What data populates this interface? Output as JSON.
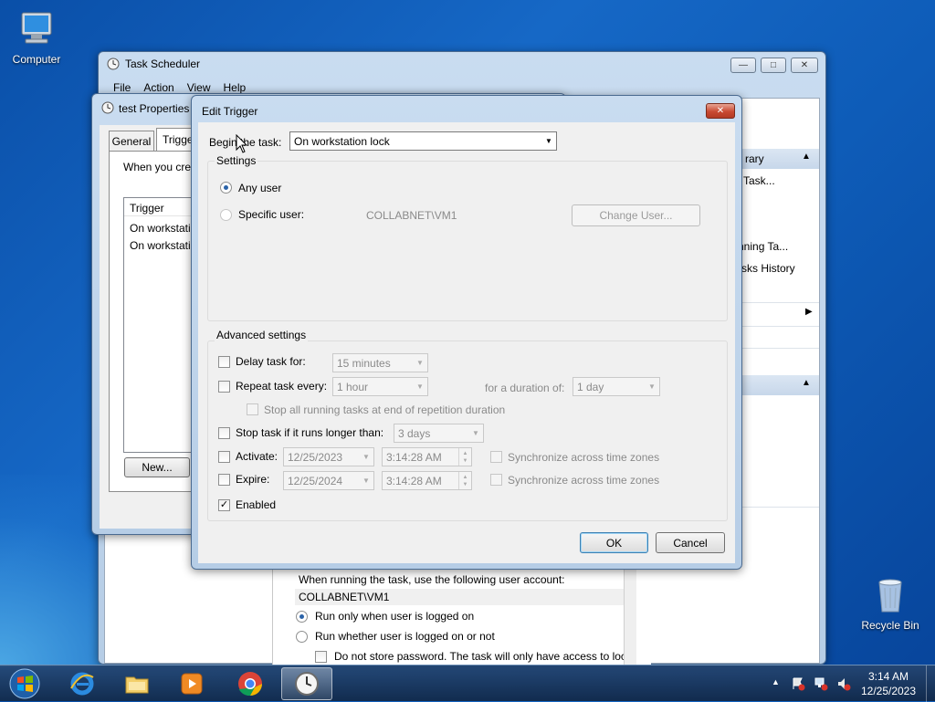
{
  "desktop": {
    "icons": [
      {
        "label": "Computer"
      },
      {
        "label": "Recycle Bin"
      }
    ]
  },
  "scheduler": {
    "title": "Task Scheduler",
    "menu": [
      "File",
      "Action",
      "View",
      "Help"
    ],
    "right_pane": {
      "items": [
        "rary",
        "Task...",
        "nning Ta...",
        "sks History"
      ]
    },
    "lower": {
      "account_text": "When running the task, use the following user account:",
      "account_value": "COLLABNET\\VM1",
      "radio1": "Run only when user is logged on",
      "radio2": "Run whether user is logged on or not",
      "checkbox": "Do not store password.  The task will only have access to loc"
    }
  },
  "properties": {
    "title": "test Properties",
    "tabs": [
      "General",
      "Trigge"
    ],
    "desc": "When you cre",
    "list_header": "Trigger",
    "rows": [
      "On workstati",
      "On workstati"
    ],
    "new_button": "New..."
  },
  "edit_trigger": {
    "title": "Edit Trigger",
    "begin_label": "Begin the task:",
    "begin_value": "On workstation lock",
    "settings_label": "Settings",
    "any_user": "Any user",
    "specific_user": "Specific user:",
    "user_value": "COLLABNET\\VM1",
    "change_user": "Change User...",
    "advanced_label": "Advanced settings",
    "delay_label": "Delay task for:",
    "delay_value": "15 minutes",
    "repeat_label": "Repeat task every:",
    "repeat_value": "1 hour",
    "duration_label": "for a duration of:",
    "duration_value": "1 day",
    "stop_running_label": "Stop all running tasks at end of repetition duration",
    "stop_longer_label": "Stop task if it runs longer than:",
    "stop_longer_value": "3 days",
    "activate_label": "Activate:",
    "activate_date": "12/25/2023",
    "activate_time": "3:14:28 AM",
    "expire_label": "Expire:",
    "expire_date": "12/25/2024",
    "expire_time": "3:14:28 AM",
    "sync_label": "Synchronize across time zones",
    "enabled_label": "Enabled",
    "ok": "OK",
    "cancel": "Cancel"
  },
  "taskbar": {
    "time": "3:14 AM",
    "date": "12/25/2023"
  },
  "colors": {
    "accent": "#2b63a8",
    "close_red": "#c94a32"
  }
}
